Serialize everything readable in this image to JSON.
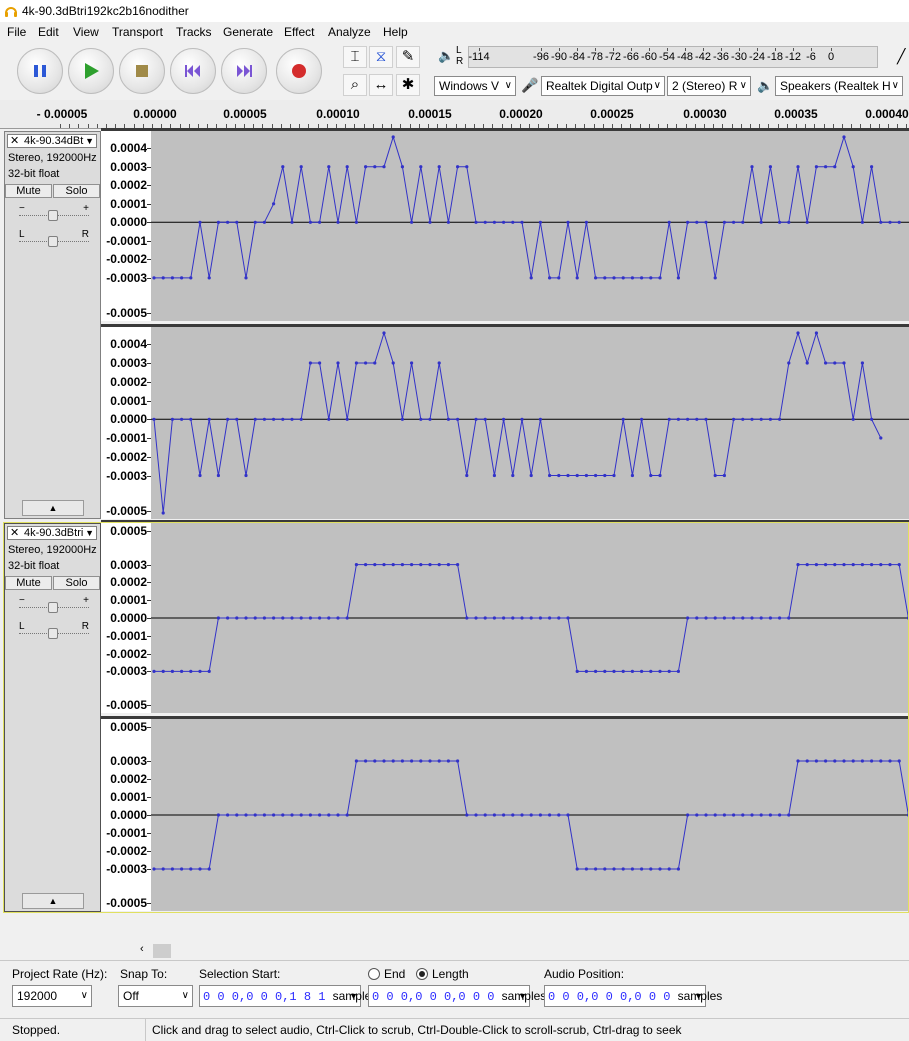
{
  "window": {
    "title": "4k-90.3dBtri192kc2b16nodither"
  },
  "menu": [
    {
      "label": "File",
      "u": "F"
    },
    {
      "label": "Edit",
      "u": "E"
    },
    {
      "label": "View",
      "u": "V"
    },
    {
      "label": "Transport",
      "u": "T"
    },
    {
      "label": "Tracks",
      "u": "T"
    },
    {
      "label": "Generate",
      "u": "G"
    },
    {
      "label": "Effect",
      "u": "c"
    },
    {
      "label": "Analyze",
      "u": "A"
    },
    {
      "label": "Help",
      "u": "H"
    }
  ],
  "meter": {
    "ticks": [
      "-114",
      "-96",
      "-90",
      "-84",
      "-78",
      "-72",
      "-66",
      "-60",
      "-54",
      "-48",
      "-42",
      "-36",
      "-30",
      "-24",
      "-18",
      "-12",
      "-6",
      "0"
    ],
    "lr": "L R"
  },
  "device": {
    "host": "Windows V",
    "recording": "Realtek Digital Outp",
    "channels": "2 (Stereo) R",
    "playback": "Speakers (Realtek H"
  },
  "ruler": {
    "ticks": [
      "- 0.00005",
      "0.00000",
      "0.00005",
      "0.00010",
      "0.00015",
      "0.00020",
      "0.00025",
      "0.00030",
      "0.00035",
      "0.00040"
    ]
  },
  "tracks": [
    {
      "name": "4k-90.34dBt",
      "format": "Stereo, 192000Hz",
      "bits": "32-bit float",
      "mute": "Mute",
      "solo": "Solo",
      "scale_left": [
        [
          "0.0004",
          "0.0003",
          "0.0002",
          "0.0001",
          "0.0000",
          "-0.0001",
          "-0.0002",
          "-0.0003",
          "-0.0005"
        ],
        [
          "0.0004",
          "0.0003",
          "0.0002",
          "0.0001",
          "0.0000",
          "-0.0001",
          "-0.0002",
          "-0.0003",
          "-0.0005"
        ]
      ]
    },
    {
      "name": "4k-90.3dBtri",
      "format": "Stereo, 192000Hz",
      "bits": "32-bit float",
      "mute": "Mute",
      "solo": "Solo",
      "scale_left": [
        [
          "0.0005",
          "0.0003",
          "0.0002",
          "0.0001",
          "0.0000",
          "-0.0001",
          "-0.0002",
          "-0.0003",
          "-0.0005"
        ],
        [
          "0.0005",
          "0.0003",
          "0.0002",
          "0.0001",
          "0.0000",
          "-0.0001",
          "-0.0002",
          "-0.0003",
          "-0.0005"
        ]
      ]
    }
  ],
  "waveforms": {
    "color": "#3232c8",
    "sample_step_samples": 1,
    "dithered_ch1": [
      -0.0003,
      -0.0003,
      -0.0003,
      -0.0003,
      -0.0003,
      0.0,
      -0.0003,
      0.0,
      0.0,
      0.0,
      -0.0003,
      0.0,
      0.0,
      0.0001,
      0.0003,
      0.0,
      0.0003,
      0.0,
      0.0,
      0.0003,
      0.0,
      0.0003,
      0.0,
      0.0003,
      0.0003,
      0.0003,
      0.00046,
      0.0003,
      0.0,
      0.0003,
      0.0,
      0.0003,
      0.0,
      0.0003,
      0.0003,
      0.0,
      0.0,
      0.0,
      0.0,
      0.0,
      0.0,
      -0.0003,
      0.0,
      -0.0003,
      -0.0003,
      0.0,
      -0.0003,
      0.0,
      -0.0003,
      -0.0003,
      -0.0003,
      -0.0003,
      -0.0003,
      -0.0003,
      -0.0003,
      -0.0003,
      0.0,
      -0.0003,
      0.0,
      0.0,
      0.0,
      -0.0003,
      0.0,
      0.0,
      0.0,
      0.0003,
      0.0,
      0.0003,
      0.0,
      0.0,
      0.0003,
      0.0,
      0.0003,
      0.0003,
      0.0003,
      0.00046,
      0.0003,
      0.0,
      0.0003,
      0.0,
      0.0,
      0.0
    ],
    "dithered_ch2": [
      0.0,
      -0.0005,
      0.0,
      0.0,
      0.0,
      -0.0003,
      0.0,
      -0.0003,
      0.0,
      0.0,
      -0.0003,
      0.0,
      0.0,
      0.0,
      0.0,
      0.0,
      0.0,
      0.0003,
      0.0003,
      0.0,
      0.0003,
      0.0,
      0.0003,
      0.0003,
      0.0003,
      0.00046,
      0.0003,
      0.0,
      0.0003,
      0.0,
      0.0,
      0.0003,
      0.0,
      0.0,
      -0.0003,
      0.0,
      0.0,
      -0.0003,
      0.0,
      -0.0003,
      0.0,
      -0.0003,
      0.0,
      -0.0003,
      -0.0003,
      -0.0003,
      -0.0003,
      -0.0003,
      -0.0003,
      -0.0003,
      -0.0003,
      0.0,
      -0.0003,
      0.0,
      -0.0003,
      -0.0003,
      0.0,
      0.0,
      0.0,
      0.0,
      0.0,
      -0.0003,
      -0.0003,
      0.0,
      0.0,
      0.0,
      0.0,
      0.0,
      0.0,
      0.0003,
      0.00046,
      0.0003,
      0.00046,
      0.0003,
      0.0003,
      0.0003,
      0.0,
      0.0003,
      0.0,
      -0.0001
    ],
    "undithered_ch1": [
      -0.0003,
      -0.0003,
      -0.0003,
      -0.0003,
      -0.0003,
      -0.0003,
      -0.0003,
      0.0,
      0.0,
      0.0,
      0.0,
      0.0,
      0.0,
      0.0,
      0.0,
      0.0,
      0.0,
      0.0,
      0.0,
      0.0,
      0.0,
      0.0,
      0.0003,
      0.0003,
      0.0003,
      0.0003,
      0.0003,
      0.0003,
      0.0003,
      0.0003,
      0.0003,
      0.0003,
      0.0003,
      0.0003,
      0.0,
      0.0,
      0.0,
      0.0,
      0.0,
      0.0,
      0.0,
      0.0,
      0.0,
      0.0,
      0.0,
      0.0,
      -0.0003,
      -0.0003,
      -0.0003,
      -0.0003,
      -0.0003,
      -0.0003,
      -0.0003,
      -0.0003,
      -0.0003,
      -0.0003,
      -0.0003,
      -0.0003,
      0.0,
      0.0,
      0.0,
      0.0,
      0.0,
      0.0,
      0.0,
      0.0,
      0.0,
      0.0,
      0.0,
      0.0,
      0.0003,
      0.0003,
      0.0003,
      0.0003,
      0.0003,
      0.0003,
      0.0003,
      0.0003,
      0.0003,
      0.0003,
      0.0003,
      0.0003,
      0.0,
      0.0
    ],
    "undithered_ch2": [
      -0.0003,
      -0.0003,
      -0.0003,
      -0.0003,
      -0.0003,
      -0.0003,
      -0.0003,
      0.0,
      0.0,
      0.0,
      0.0,
      0.0,
      0.0,
      0.0,
      0.0,
      0.0,
      0.0,
      0.0,
      0.0,
      0.0,
      0.0,
      0.0,
      0.0003,
      0.0003,
      0.0003,
      0.0003,
      0.0003,
      0.0003,
      0.0003,
      0.0003,
      0.0003,
      0.0003,
      0.0003,
      0.0003,
      0.0,
      0.0,
      0.0,
      0.0,
      0.0,
      0.0,
      0.0,
      0.0,
      0.0,
      0.0,
      0.0,
      0.0,
      -0.0003,
      -0.0003,
      -0.0003,
      -0.0003,
      -0.0003,
      -0.0003,
      -0.0003,
      -0.0003,
      -0.0003,
      -0.0003,
      -0.0003,
      -0.0003,
      0.0,
      0.0,
      0.0,
      0.0,
      0.0,
      0.0,
      0.0,
      0.0,
      0.0,
      0.0,
      0.0,
      0.0,
      0.0003,
      0.0003,
      0.0003,
      0.0003,
      0.0003,
      0.0003,
      0.0003,
      0.0003,
      0.0003,
      0.0003,
      0.0003,
      0.0003,
      0.0,
      0.0
    ]
  },
  "selection": {
    "project_rate_label": "Project Rate (Hz):",
    "project_rate": "192000",
    "snap_label": "Snap To:",
    "snap_value": "Off",
    "selection_start_label": "Selection Start:",
    "selection_start": "0 0 0,0 0 0,1 8 1",
    "end_label": "End",
    "length_label": "Length",
    "length_value": "0 0 0,0 0 0,0 0 0",
    "audio_position_label": "Audio Position:",
    "audio_position": "0 0 0,0 0 0,0 0 0",
    "unit": "samples"
  },
  "status": {
    "state": "Stopped.",
    "hint": "Click and drag to select audio, Ctrl-Click to scrub, Ctrl-Double-Click to scroll-scrub, Ctrl-drag to seek"
  }
}
